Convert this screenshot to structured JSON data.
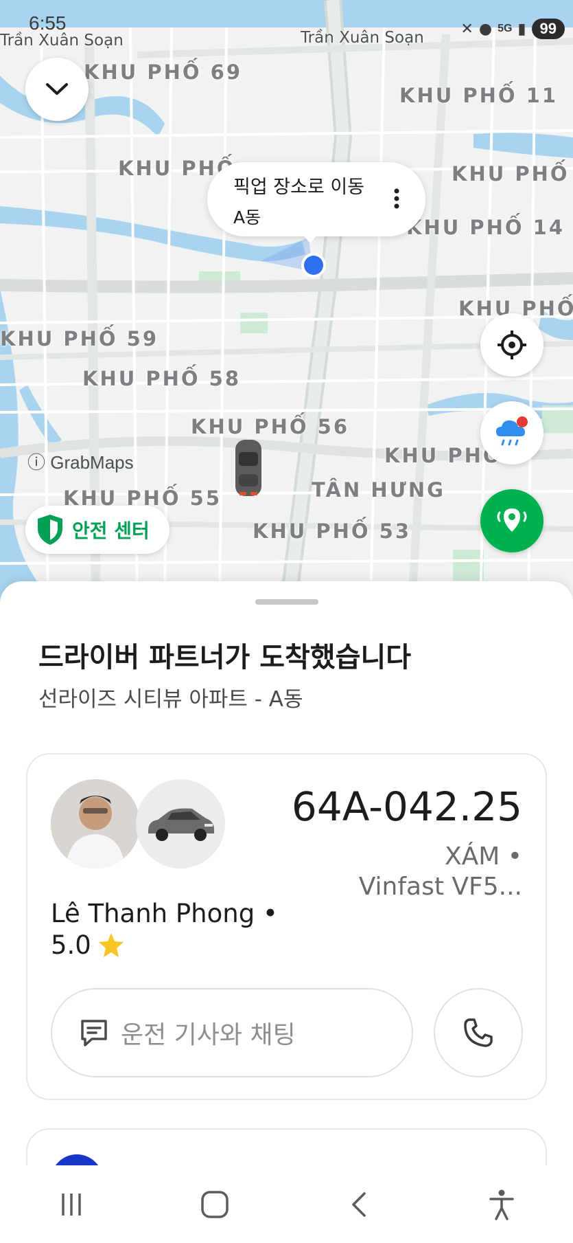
{
  "status_bar": {
    "time": "6:55",
    "battery": "99",
    "network": "5G"
  },
  "map": {
    "street_labels": [
      "Trần Xuân Soạn",
      "Trần Xuân Soạn",
      "GrabMaps"
    ],
    "area_labels": [
      "KHU PHỐ 69",
      "KHU PHỐ 11",
      "KHU PHỐ",
      "KHU PHỐ",
      "KHU PHỐ 14",
      "KHU PHỐ",
      "KHU PHỐ 59",
      "KHU PHỐ 58",
      "KHU PHỐ 56",
      "KHU PHỐ",
      "KHU PHỐ 55",
      "TÂN HƯNG",
      "KHU PHỐ 53"
    ],
    "pickup_bubble": {
      "title": "픽업 장소로 이동",
      "subtitle": "A동"
    },
    "safety_center_label": "안전 센터",
    "icons": [
      "chevron-down-icon",
      "locate-icon",
      "weather-rain-icon",
      "safety-pin-icon",
      "shield-icon"
    ],
    "accent_green": "#00b14f",
    "accent_blue": "#2f6fed"
  },
  "sheet": {
    "title": "드라이버 파트너가 도착했습니다",
    "subtitle": "선라이즈 시티뷰 아파트 - A동",
    "driver": {
      "plate": "64A-042.25",
      "car_color": "XÁM •",
      "car_model": "Vinfast VF5...",
      "name": "Lê Thanh Phong •",
      "rating": "5.0"
    },
    "chat_placeholder": "운전 기사와 채팅"
  },
  "navbar": {
    "icons": [
      "recent-apps-icon",
      "home-icon",
      "back-icon",
      "accessibility-icon"
    ]
  }
}
